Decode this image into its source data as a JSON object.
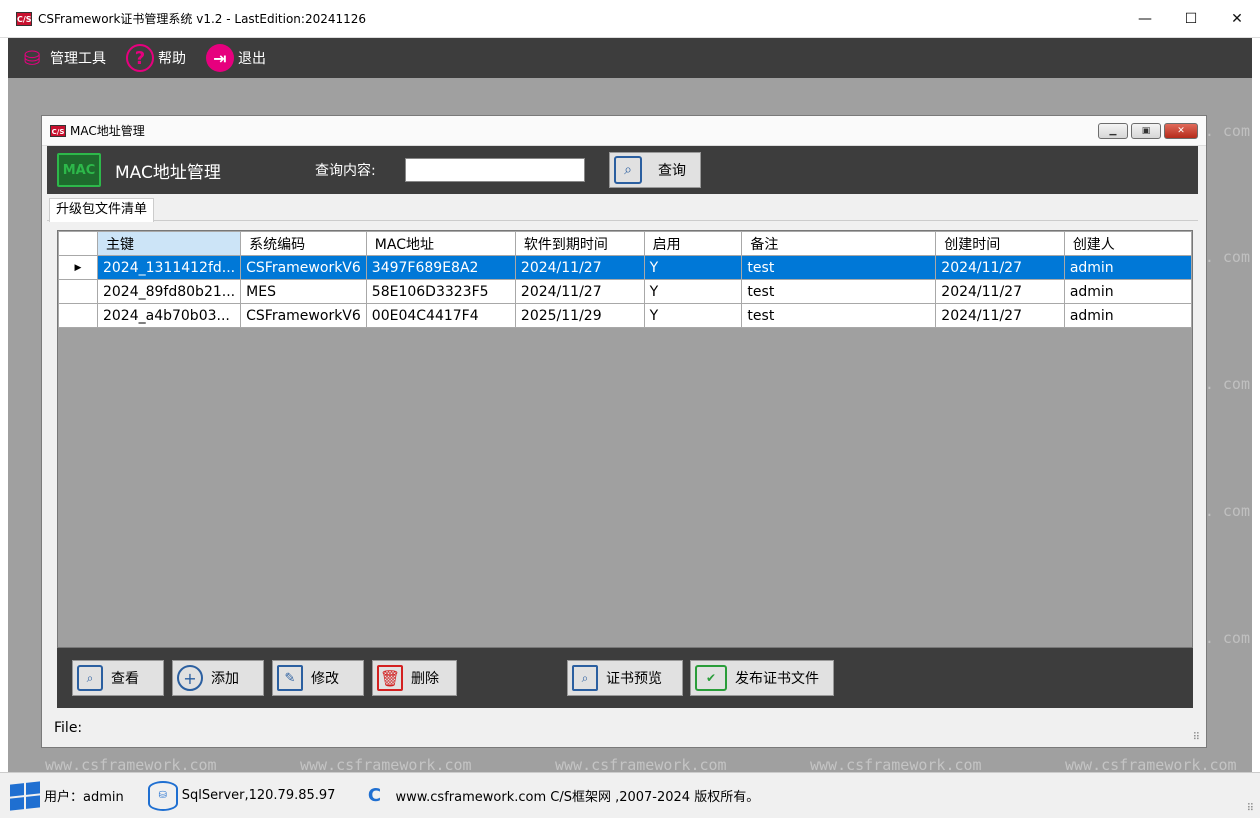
{
  "window": {
    "logo_text": "C/S",
    "title": "CSFramework证书管理系统 v1.2 - LastEdition:20241126",
    "minimize": "—",
    "maximize": "☐",
    "close": "✕"
  },
  "menubar": {
    "items": [
      {
        "label": "管理工具",
        "icon": "database-gear-icon"
      },
      {
        "label": "帮助",
        "icon": "help-icon"
      },
      {
        "label": "退出",
        "icon": "exit-icon"
      }
    ]
  },
  "watermark": {
    "side_text": ". com",
    "bottom_text": "www.csframework.com"
  },
  "child_window": {
    "logo_text": "C/S",
    "title": "MAC地址管理",
    "header_icon_text": "MAC",
    "header_title": "MAC地址管理",
    "query_label": "查询内容:",
    "query_value": "",
    "query_button": "查询",
    "tab_label": "升级包文件清单"
  },
  "grid": {
    "columns": [
      "主键",
      "系统编码",
      "MAC地址",
      "软件到期时间",
      "启用",
      "备注",
      "创建时间",
      "创建人"
    ],
    "rows": [
      [
        "2024_1311412fd...",
        "CSFrameworkV6",
        "3497F689E8A2",
        "2024/11/27",
        "Y",
        "test",
        "2024/11/27",
        "admin"
      ],
      [
        "2024_89fd80b21...",
        "MES",
        "58E106D3323F5",
        "2024/11/27",
        "Y",
        "test",
        "2024/11/27",
        "admin"
      ],
      [
        "2024_a4b70b03...",
        "CSFrameworkV6",
        "00E04C4417F4",
        "2025/11/29",
        "Y",
        "test",
        "2024/11/27",
        "admin"
      ]
    ],
    "selected_row_marker": "▶"
  },
  "actions": {
    "view": "查看",
    "add": "添加",
    "edit": "修改",
    "delete": "删除",
    "cert_preview": "证书预览",
    "publish_cert": "发布证书文件"
  },
  "file_label": "File:",
  "statusbar": {
    "user": "用户：admin",
    "db": "SqlServer,120.79.85.97",
    "copyright": "www.csframework.com C/S框架网 ,2007-2024 版权所有。"
  },
  "colors": {
    "accent": "#e6007e",
    "dark_bar": "#3d3d3d",
    "selected_row": "#0078d7",
    "desktop": "#a0a0a0"
  }
}
